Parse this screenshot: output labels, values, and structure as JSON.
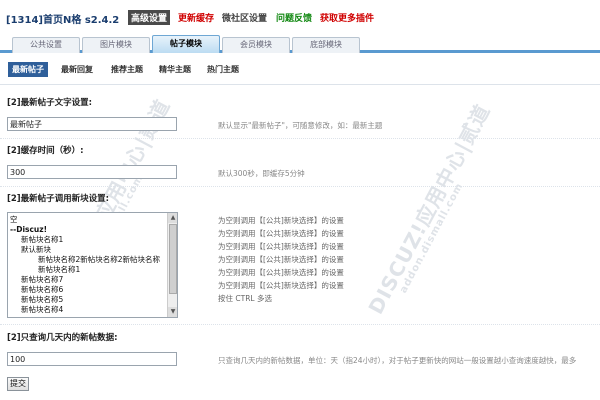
{
  "header": {
    "title": "[1314]首页N格 s2.4.2",
    "links": [
      {
        "label": "高级设置"
      },
      {
        "label": "更新缓存"
      },
      {
        "label": "微社区设置"
      },
      {
        "label": "问题反馈"
      },
      {
        "label": "获取更多插件"
      }
    ]
  },
  "tabs": [
    "公共设置",
    "图片模块",
    "帖子模块",
    "会员模块",
    "底部模块"
  ],
  "subtabs": [
    "最新帖子",
    "最新回复",
    "推荐主题",
    "精华主题",
    "热门主题"
  ],
  "settings": {
    "text": {
      "label": "[2]最新帖子文字设置:",
      "value": "最新帖子",
      "hint": "默认显示\"最新帖子\"，可随意修改，如：最新主题"
    },
    "cache": {
      "label": "[2]缓存时间（秒）:",
      "value": "300",
      "hint": "默认300秒，即缓存5分钟"
    },
    "blocks": {
      "label": "[2]最新帖子调用新块设置:",
      "options": [
        "空",
        "--Discuz!",
        "新帖块名称1",
        "默认新块",
        "新帖块名称2新帖块名称2新帖块名称",
        "新帖块名称1",
        "新帖块名称7",
        "新帖块名称6",
        "新帖块名称5",
        "新帖块名称4"
      ],
      "hints": [
        "为空则调用【[公共]新块选择】的设置",
        "为空则调用【[公共]新块选择】的设置",
        "为空则调用【[公共]新块选择】的设置",
        "为空则调用【[公共]新块选择】的设置",
        "为空则调用【[公共]新块选择】的设置",
        "为空则调用【[公共]新块选择】的设置",
        "按住 CTRL 多选"
      ]
    },
    "days": {
      "label": "[2]只查询几天内的新帖数据:",
      "value": "100",
      "hint": "只查询几天内的新帖数据，单位：天（指24小时），对于帖子更新快的网站一般设置越小查询速度越快，最多"
    }
  },
  "submit_label": "提交",
  "watermarks": {
    "main": "DISCUZ!应用中心|贰道",
    "sub": "addon.dismall.com"
  }
}
